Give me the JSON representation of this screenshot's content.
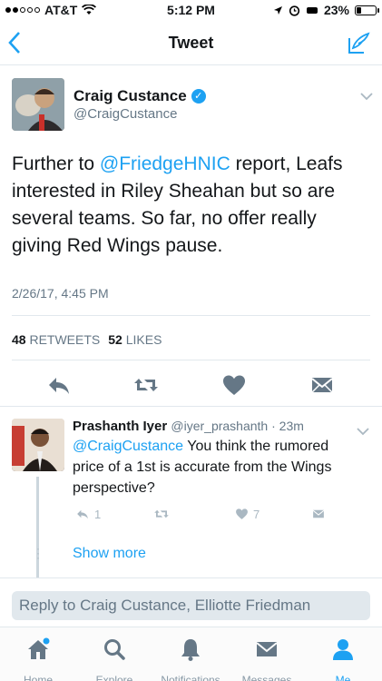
{
  "status_bar": {
    "carrier": "AT&T",
    "time": "5:12 PM",
    "battery": "23%"
  },
  "nav": {
    "title": "Tweet"
  },
  "tweet": {
    "author_name": "Craig Custance",
    "handle": "@CraigCustance",
    "text_mention": "@FriedgeHNIC",
    "text_lines": [
      "Further to",
      " report, Leafs",
      "interested in Riley Sheahan but so are",
      "several teams. So far, no offer really",
      "giving Red Wings pause."
    ],
    "timestamp": "2/26/17, 4:45 PM",
    "retweets_count": "48",
    "retweets_label": "RETWEETS",
    "likes_count": "52",
    "likes_label": "LIKES"
  },
  "reply": {
    "author_name": "Prashanth Iyer",
    "handle_time": "@iyer_prashanth · 23m",
    "mention": "@CraigCustance",
    "text_line1_rest": " You think the rumored",
    "text_line2": "price of a 1st is accurate from the Wings",
    "text_line3": "perspective?",
    "reply_count": "1",
    "like_count": "7",
    "show_more": "Show more"
  },
  "reply_box": {
    "placeholder": "Reply to Craig Custance, Elliotte Friedman"
  },
  "tabs": [
    {
      "label": "Home",
      "icon": "home-icon"
    },
    {
      "label": "Explore",
      "icon": "search-icon"
    },
    {
      "label": "Notifications",
      "icon": "bell-icon"
    },
    {
      "label": "Messages",
      "icon": "envelope-icon"
    },
    {
      "label": "Me",
      "icon": "person-icon"
    }
  ],
  "colors": {
    "accent": "#1da1f2",
    "muted": "#657786",
    "icon_gray": "#657786",
    "border": "#e1e8ed"
  }
}
